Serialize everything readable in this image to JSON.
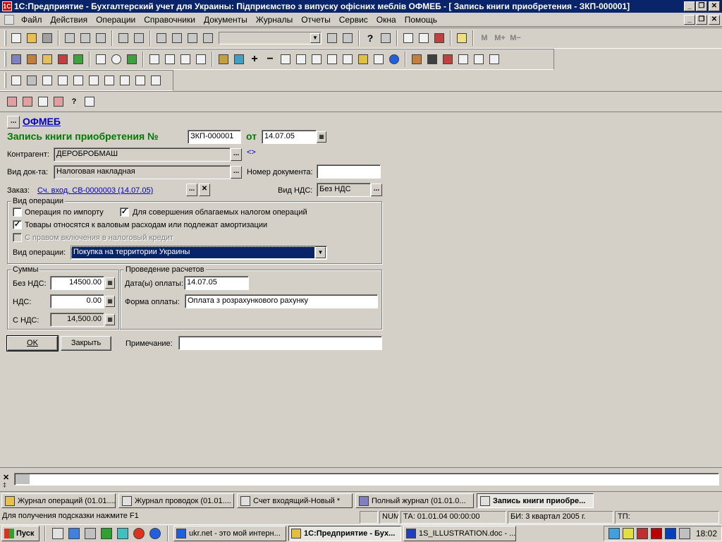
{
  "window": {
    "title": "1С:Предприятие - Бухгалтерский учет для Украины: Підприємство з випуску офісних меблів ОФМЕБ - [ Запись книги приобретения - ЗКП-000001]"
  },
  "menu": [
    "Файл",
    "Действия",
    "Операции",
    "Справочники",
    "Документы",
    "Журналы",
    "Отчеты",
    "Сервис",
    "Окна",
    "Помощь"
  ],
  "toolbar": {
    "calc_m": "M",
    "calc_mplus": "M+",
    "calc_mminus": "M−"
  },
  "form": {
    "company_link": "ОФМЕБ",
    "company_btn": "...",
    "heading": "Запись книги приобретения №",
    "number": "ЗКП-000001",
    "from_label": "от",
    "date": "14.07.05",
    "counterparty_label": "Контрагент:",
    "counterparty": "ДЕРОБРОБМАШ",
    "doc_type_label": "Вид док-та:",
    "doc_type": "Налоговая накладная",
    "doc_number_label": "Номер документа:",
    "doc_number": "",
    "order_label": "Заказ:",
    "order_link": "Сч. вход. СВ-0000003 (14.07.05)",
    "vat_type_label": "Вид НДС:",
    "vat_type": "Без НДС",
    "op_group_title": "Вид операции",
    "cb_import": "Операция по импорту",
    "cb_taxable": "Для совершения облагаемых налогом операций",
    "cb_gross": "Товары относятся к валовым расходам или подлежат амортизации",
    "cb_credit": "С правом включения в налоговый кредит",
    "op_kind_label": "Вид операции:",
    "op_kind": "Покупка на территории Украины",
    "sums_title": "Суммы",
    "no_vat_label": "Без НДС:",
    "no_vat": "14500.00",
    "vat_label": "НДС:",
    "vat": "0.00",
    "with_vat_label": "С НДС:",
    "with_vat": "14,500.00",
    "payment_title": "Проведение расчетов",
    "pay_date_label": "Дата(ы) оплаты:",
    "pay_date": "14.07.05",
    "pay_form_label": "Форма оплаты:",
    "pay_form": "Оплата з розрахункового рахунку",
    "ok": "OK",
    "close": "Закрыть",
    "note_label": "Примечание:",
    "note": ""
  },
  "windows_bar": [
    "Журнал операций (01.01....",
    "Журнал проводок (01.01....",
    "Счет входящий-Новый *",
    "Полный журнал (01.01.0...",
    "Запись книги приобре..."
  ],
  "status": {
    "hint": "Для получения подсказки нажмите F1",
    "num": "NUM",
    "ta": "ТА: 01.01.04  00:00:00",
    "bi": "БИ: 3 квартал 2005 г.",
    "tp": "ТП:"
  },
  "taskbar": {
    "start": "Пуск",
    "tasks": [
      "ukr.net - это мой интерн...",
      "1С:Предприятие - Бух...",
      "1S_ILLUSTRATION.doc - ..."
    ],
    "clock": "18:02"
  }
}
